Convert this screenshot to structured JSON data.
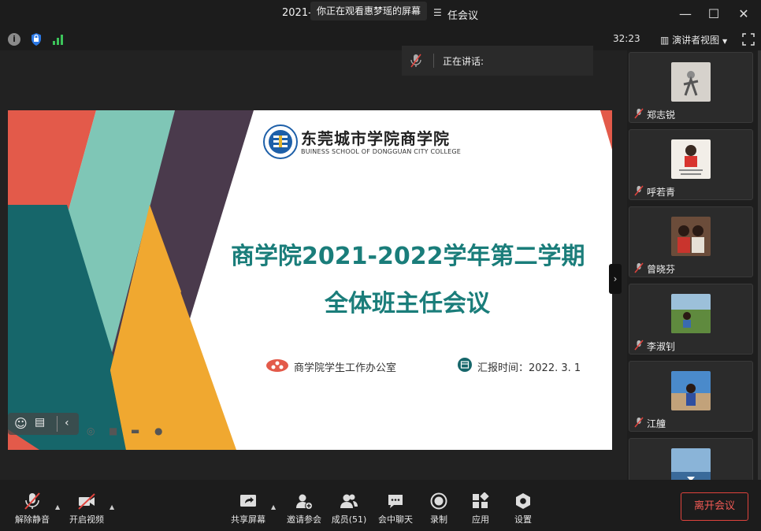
{
  "window": {
    "title_left": "2021-",
    "title_right": "任会议",
    "share_tip": "你正在观看惠梦瑶的屏幕"
  },
  "status": {
    "timer": "32:23",
    "view_mode": "演讲者视图"
  },
  "speaking": {
    "label": "正在讲话:"
  },
  "slide": {
    "school_cn": "东莞城市学院商学院",
    "school_en": "BUINESS SCHOOL OF DONGGUAN CITY COLLEGE",
    "title_line1": "商学院2021-2022学年第二学期",
    "title_line2": "全体班主任会议",
    "office": "商学院学生工作办公室",
    "report_time": "汇报时间：2022. 3. 1",
    "colors": {
      "red": "#e35a4a",
      "mint": "#7fc6b6",
      "plum": "#4a3a4c",
      "teal": "#16666a",
      "orange": "#f0a830",
      "title": "#1a7d7a"
    }
  },
  "participants": [
    {
      "name": "郑志锐"
    },
    {
      "name": "呼若青"
    },
    {
      "name": "曾晓芬"
    },
    {
      "name": "李淑钊"
    },
    {
      "name": "江艟"
    },
    {
      "name": ""
    }
  ],
  "toolbar": {
    "unmute": "解除静音",
    "start_video": "开启视频",
    "share_screen": "共享屏幕",
    "invite": "邀请参会",
    "members": "成员(51)",
    "chat": "会中聊天",
    "record": "录制",
    "apps": "应用",
    "settings": "设置",
    "leave": "离开会议"
  },
  "icons": [
    "info-icon",
    "shield-icon",
    "signal-icon",
    "fullscreen-icon",
    "mic-muted-icon",
    "video-off-icon",
    "share-icon",
    "invite-icon",
    "members-icon",
    "chat-icon",
    "record-icon",
    "apps-icon",
    "settings-icon"
  ]
}
